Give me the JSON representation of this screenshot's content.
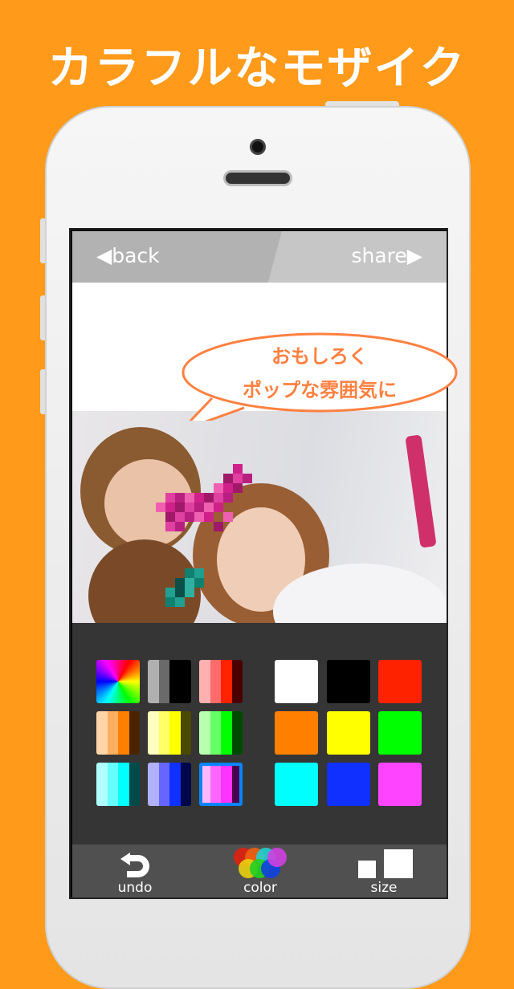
{
  "headline": "カラフルなモザイク",
  "nav": {
    "back_label": "◀back",
    "share_label": "share▶"
  },
  "bubble": {
    "line1": "おもしろく",
    "line2": "ポップな雰囲気に",
    "color": "#ff8040"
  },
  "palette": {
    "gradients": [
      {
        "name": "rainbow",
        "colors": []
      },
      {
        "name": "gray",
        "colors": [
          "#b0b0b0",
          "#6a6a6a",
          "#000000",
          "#000000"
        ]
      },
      {
        "name": "red",
        "colors": [
          "#ffb0b0",
          "#ff6a6a",
          "#ff2200",
          "#4a0000"
        ]
      },
      {
        "name": "orange",
        "colors": [
          "#ffd5a8",
          "#ffae60",
          "#ff8000",
          "#4a2400"
        ]
      },
      {
        "name": "yellow",
        "colors": [
          "#ffffc0",
          "#ffff66",
          "#ffff00",
          "#4a4a00"
        ]
      },
      {
        "name": "green",
        "colors": [
          "#b8ffb0",
          "#66ff66",
          "#00ff00",
          "#004a00"
        ]
      },
      {
        "name": "cyan",
        "colors": [
          "#b0ffff",
          "#66ffff",
          "#00ffff",
          "#004a4a"
        ]
      },
      {
        "name": "blue",
        "colors": [
          "#b0b0ff",
          "#6666ff",
          "#1030ff",
          "#00084a"
        ]
      },
      {
        "name": "magenta",
        "colors": [
          "#ffb8ff",
          "#ff66ff",
          "#ff33ff",
          "#4a004a"
        ],
        "selected": true
      }
    ],
    "solids": [
      "#ffffff",
      "#000000",
      "#ff2200",
      "#ff8000",
      "#ffff00",
      "#00ff00",
      "#00ffff",
      "#1030ff",
      "#ff44ff"
    ],
    "selected_color": "#0a84ff"
  },
  "toolbar": {
    "undo_label": "undo",
    "color_label": "color",
    "size_label": "size"
  }
}
